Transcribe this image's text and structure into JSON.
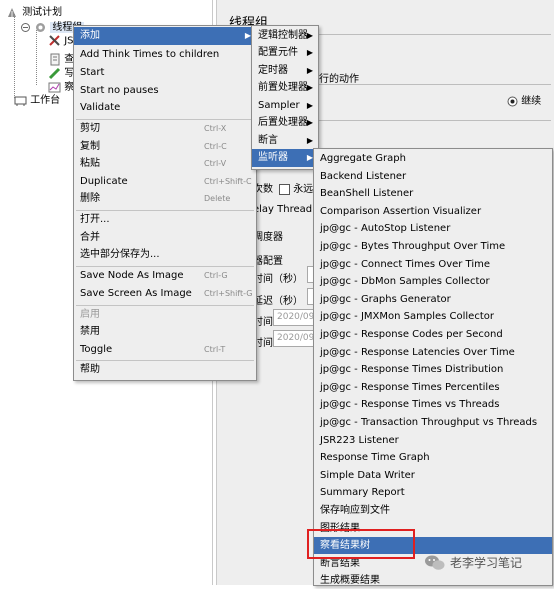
{
  "tree": {
    "test_plan": "测试计划",
    "thread_group": "线程组",
    "child_labels": [
      "JS",
      "查",
      "写",
      "察"
    ],
    "workbench": "工作台"
  },
  "right_panel": {
    "title": "线程组",
    "label_action": "执行的动作",
    "radio_continue": "继续",
    "label_loop": "次数",
    "checkbox_forever": "永远",
    "label_delay": "elay Thread cr",
    "label_scheduler": "调度器",
    "label_scheduler_config": "器配置",
    "label_duration": "时间（秒）",
    "label_startup_delay": "延迟（秒）",
    "label_start_time": "时间",
    "value_start_time": "2020/09/",
    "label_end_time": "时间",
    "value_end_time": "2020/09/"
  },
  "context_menu": {
    "items": [
      {
        "label": "添加",
        "submenu": true,
        "selected": true
      },
      {
        "label": "Add Think Times to children"
      },
      {
        "label": "Start"
      },
      {
        "label": "Start no pauses"
      },
      {
        "label": "Validate"
      },
      {
        "label": "剪切",
        "shortcut": "Ctrl-X"
      },
      {
        "label": "复制",
        "shortcut": "Ctrl-C"
      },
      {
        "label": "粘贴",
        "shortcut": "Ctrl-V"
      },
      {
        "label": "Duplicate",
        "shortcut": "Ctrl+Shift-C"
      },
      {
        "label": "删除",
        "shortcut": "Delete"
      },
      {
        "label": "打开..."
      },
      {
        "label": "合并"
      },
      {
        "label": "选中部分保存为..."
      },
      {
        "label": "Save Node As Image",
        "shortcut": "Ctrl-G"
      },
      {
        "label": "Save Screen As Image",
        "shortcut": "Ctrl+Shift-G"
      },
      {
        "label": "启用",
        "disabled": true
      },
      {
        "label": "禁用"
      },
      {
        "label": "Toggle",
        "shortcut": "Ctrl-T"
      },
      {
        "label": "帮助"
      }
    ]
  },
  "add_submenu": {
    "items": [
      {
        "label": "逻辑控制器"
      },
      {
        "label": "配置元件"
      },
      {
        "label": "定时器"
      },
      {
        "label": "前置处理器"
      },
      {
        "label": "Sampler"
      },
      {
        "label": "后置处理器"
      },
      {
        "label": "断言"
      },
      {
        "label": "监听器",
        "selected": true
      }
    ]
  },
  "listener_submenu": {
    "items": [
      "Aggregate Graph",
      "Backend Listener",
      "BeanShell Listener",
      "Comparison Assertion Visualizer",
      "jp@gc - AutoStop Listener",
      "jp@gc - Bytes Throughput Over Time",
      "jp@gc - Connect Times Over Time",
      "jp@gc - DbMon Samples Collector",
      "jp@gc - Graphs Generator",
      "jp@gc - JMXMon Samples Collector",
      "jp@gc - Response Codes per Second",
      "jp@gc - Response Latencies Over Time",
      "jp@gc - Response Times Distribution",
      "jp@gc - Response Times Percentiles",
      "jp@gc - Response Times vs Threads",
      "jp@gc - Transaction Throughput vs Threads",
      "JSR223 Listener",
      "Response Time Graph",
      "Simple Data Writer",
      "Summary Report",
      "保存响应到文件",
      "图形结果",
      "察看结果树",
      "断言结果",
      "生成概要结果"
    ],
    "selected_index": 22
  },
  "watermark": {
    "text": "老李学习笔记"
  },
  "colors": {
    "selection": "#3d6fb5",
    "highlight_box": "#e02020",
    "menu_bg": "#eeeeee"
  }
}
